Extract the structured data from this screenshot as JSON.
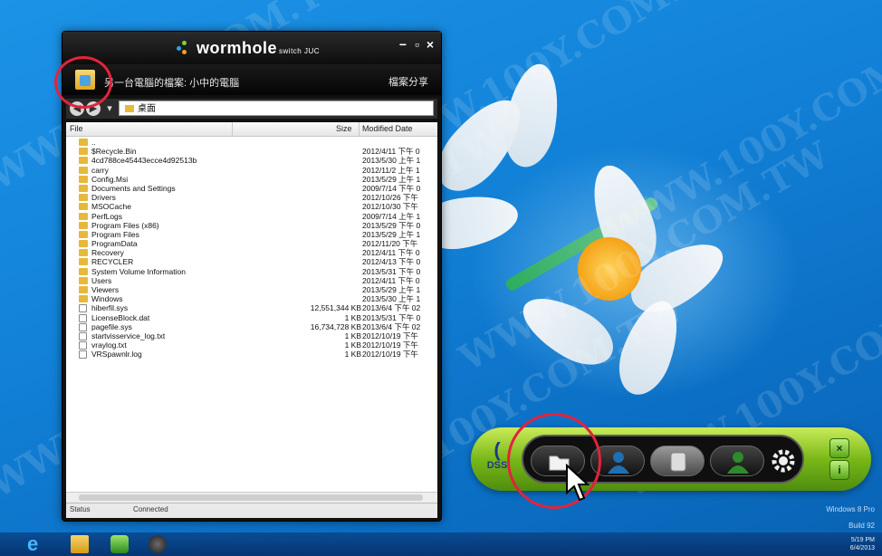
{
  "window": {
    "title": "wormhole",
    "title_sub": "switch  JUC",
    "minimize": "−",
    "maximize": "▫",
    "close": "×",
    "path_title": "另一台電腦的檔案: 小中的電腦",
    "share_label": "檔案分享",
    "address": "桌面",
    "columns": {
      "file": "File",
      "size": "Size",
      "modified": "Modified Date"
    },
    "files": [
      {
        "name": "..",
        "size": "",
        "date": "",
        "type": "folder"
      },
      {
        "name": "$Recycle.Bin",
        "size": "",
        "date": "2012/4/11 下午 0",
        "type": "folder"
      },
      {
        "name": "4cd788ce45443ecce4d92513b",
        "size": "",
        "date": "2013/5/30 上午 1",
        "type": "folder"
      },
      {
        "name": "carry",
        "size": "",
        "date": "2012/11/2 上午 1",
        "type": "folder"
      },
      {
        "name": "Config.Msi",
        "size": "",
        "date": "2013/5/29 上午 1",
        "type": "folder"
      },
      {
        "name": "Documents and Settings",
        "size": "",
        "date": "2009/7/14 下午 0",
        "type": "folder"
      },
      {
        "name": "Drivers",
        "size": "",
        "date": "2012/10/26 下午",
        "type": "folder"
      },
      {
        "name": "MSOCache",
        "size": "",
        "date": "2012/10/30 下午",
        "type": "folder"
      },
      {
        "name": "PerfLogs",
        "size": "",
        "date": "2009/7/14 上午 1",
        "type": "folder"
      },
      {
        "name": "Program Files (x86)",
        "size": "",
        "date": "2013/5/29 下午 0",
        "type": "folder"
      },
      {
        "name": "Program Files",
        "size": "",
        "date": "2013/5/29 上午 1",
        "type": "folder"
      },
      {
        "name": "ProgramData",
        "size": "",
        "date": "2012/11/20 下午",
        "type": "folder"
      },
      {
        "name": "Recovery",
        "size": "",
        "date": "2012/4/11 下午 0",
        "type": "folder"
      },
      {
        "name": "RECYCLER",
        "size": "",
        "date": "2012/4/13 下午 0",
        "type": "folder"
      },
      {
        "name": "System Volume Information",
        "size": "",
        "date": "2013/5/31 下午 0",
        "type": "folder"
      },
      {
        "name": "Users",
        "size": "",
        "date": "2012/4/11 下午 0",
        "type": "folder"
      },
      {
        "name": "Viewers",
        "size": "",
        "date": "2013/5/29 上午 1",
        "type": "folder"
      },
      {
        "name": "Windows",
        "size": "",
        "date": "2013/5/30 上午 1",
        "type": "folder"
      },
      {
        "name": "hiberfil.sys",
        "size": "12,551,344 KB",
        "date": "2013/6/4 下午 02",
        "type": "file"
      },
      {
        "name": "LicenseBlock.dat",
        "size": "1 KB",
        "date": "2013/5/31 下午 0",
        "type": "file"
      },
      {
        "name": "pagefile.sys",
        "size": "16,734,728 KB",
        "date": "2013/6/4 下午 02",
        "type": "file"
      },
      {
        "name": "startvisservice_log.txt",
        "size": "1 KB",
        "date": "2012/10/19 下午",
        "type": "file"
      },
      {
        "name": "vraylog.txt",
        "size": "1 KB",
        "date": "2012/10/19 下午",
        "type": "file"
      },
      {
        "name": "VRSpawnlr.log",
        "size": "1 KB",
        "date": "2012/10/19 下午",
        "type": "file"
      }
    ],
    "status_label": "Status",
    "status_value": "Connected"
  },
  "dock": {
    "dss_label": "DSS",
    "buttons": [
      "folder-icon",
      "user-blue-icon",
      "device-icon",
      "user-green-icon",
      "gear-icon"
    ],
    "side_close": "×",
    "side_info": "i"
  },
  "taskbar": {
    "icons": [
      "ie-icon",
      "explorer-icon",
      "app-icon",
      "app2-icon"
    ],
    "tray_time": "5/19 PM",
    "tray_date": "6/4/2013"
  },
  "desktop": {
    "os_label": "Windows 8 Pro",
    "build_label": "Build 92"
  },
  "watermark": "WWW.100Y.COM.TW"
}
